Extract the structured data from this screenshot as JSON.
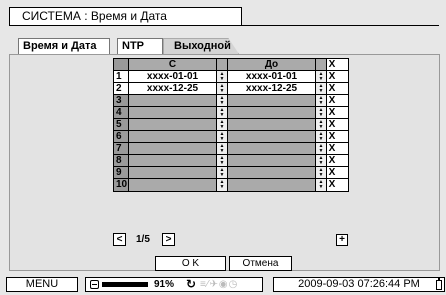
{
  "title": "СИСТЕМА : Время и Дата",
  "tabs": [
    {
      "label": "Время и Дата"
    },
    {
      "label": "NTP"
    },
    {
      "label": "Выходной"
    }
  ],
  "grid": {
    "col_from": "С",
    "col_to": "До",
    "col_delete": "X",
    "spin_up": "▲",
    "spin_down": "▼",
    "rows": [
      {
        "num": "1",
        "from": "xxxx-01-01",
        "to": "xxxx-01-01",
        "del": "X"
      },
      {
        "num": "2",
        "from": "xxxx-12-25",
        "to": "xxxx-12-25",
        "del": "X"
      },
      {
        "num": "3",
        "from": "",
        "to": "",
        "del": "X"
      },
      {
        "num": "4",
        "from": "",
        "to": "",
        "del": "X"
      },
      {
        "num": "5",
        "from": "",
        "to": "",
        "del": "X"
      },
      {
        "num": "6",
        "from": "",
        "to": "",
        "del": "X"
      },
      {
        "num": "7",
        "from": "",
        "to": "",
        "del": "X"
      },
      {
        "num": "8",
        "from": "",
        "to": "",
        "del": "X"
      },
      {
        "num": "9",
        "from": "",
        "to": "",
        "del": "X"
      },
      {
        "num": "10",
        "from": "",
        "to": "",
        "del": "X"
      }
    ]
  },
  "pager": {
    "prev": "<",
    "text": "1/5",
    "next": ">",
    "add": "+"
  },
  "buttons": {
    "ok": "O K",
    "cancel": "Отмена"
  },
  "status": {
    "menu": "MENU",
    "disk_percent": "91%",
    "disk_fill": 0.91,
    "rec_icon": "↻",
    "faint_icons": "≡⁄✈◉◷",
    "datetime": "2009-09-03 07:26:44 PM"
  }
}
